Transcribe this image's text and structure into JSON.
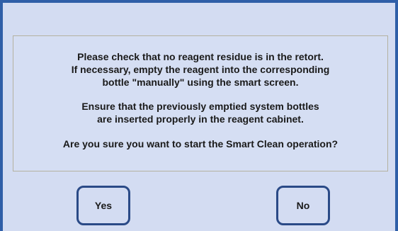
{
  "dialog": {
    "message_lines": [
      "Please check that no reagent residue is in the retort.",
      "If necessary, empty the reagent into the corresponding",
      "bottle \"manually\" using the smart screen.",
      "Ensure that the previously emptied system bottles",
      "are inserted properly in the reagent cabinet.",
      "Are you sure you want to start the Smart Clean operation?"
    ],
    "yes_label": "Yes",
    "no_label": "No"
  },
  "colors": {
    "background": "#d3dcf2",
    "border": "#2f5fa8",
    "button_border": "#2a4a87"
  }
}
